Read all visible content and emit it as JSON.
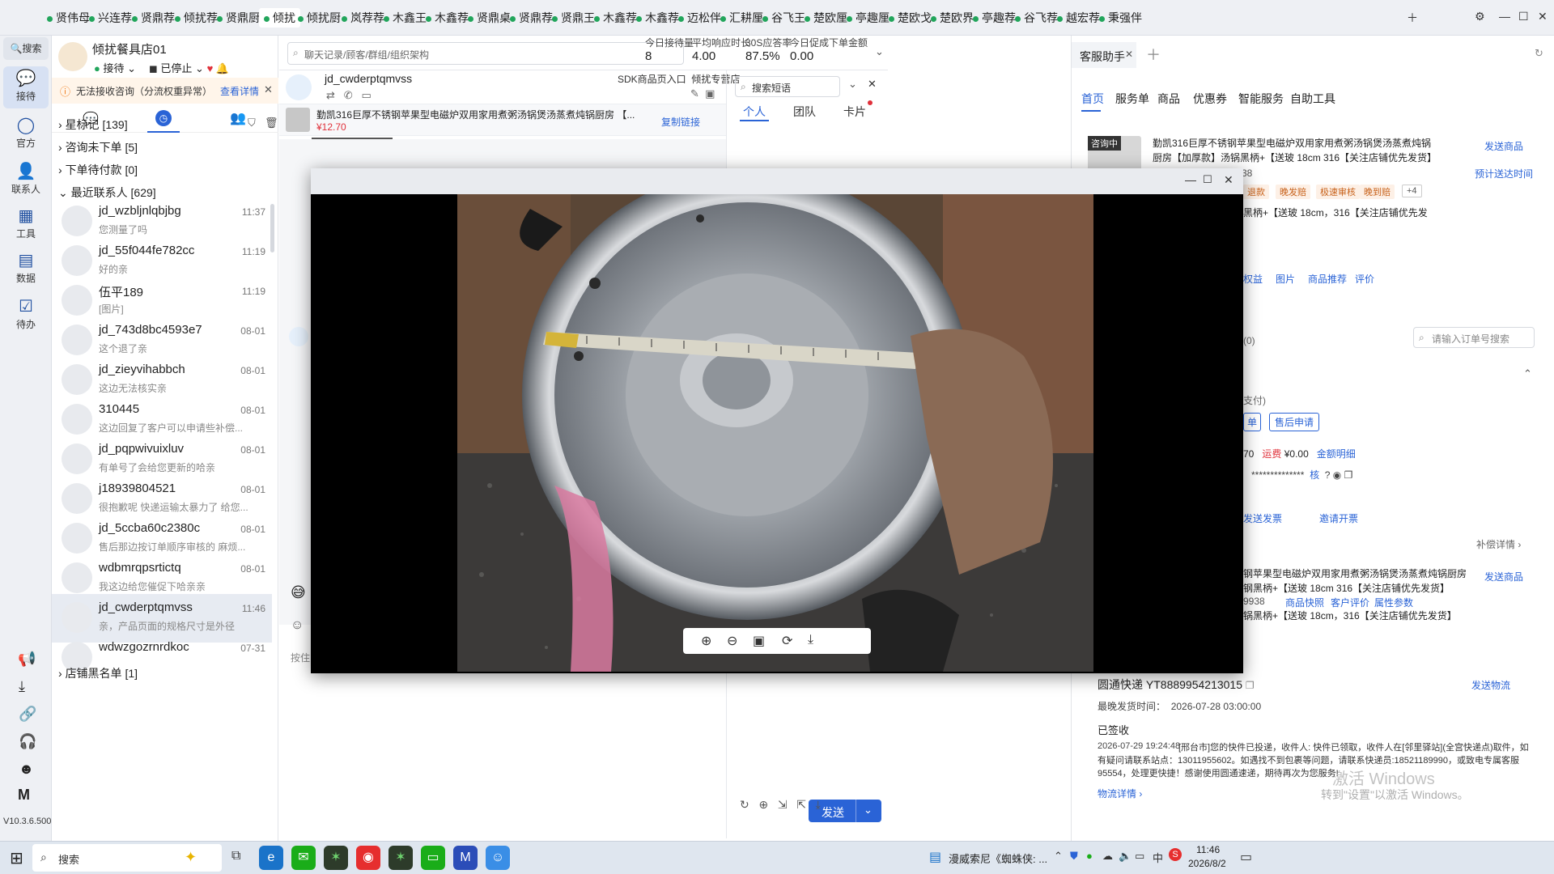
{
  "top_tabs": [
    "贤伟母",
    "兴连荐",
    "贤鼎荐",
    "倾扰荐",
    "贤鼎厨",
    "倾扰",
    "倾扰厨",
    "岚荐荐",
    "木鑫王",
    "木鑫荐",
    "贤鼎桌",
    "贤鼎荐",
    "贤鼎王",
    "木鑫荐",
    "木鑫荐",
    "迈松伴",
    "汇耕厘",
    "谷飞王",
    "楚欧厘",
    "亭趣厘",
    "楚欧戈",
    "楚欧界",
    "亭趣荐",
    "谷飞荐",
    "越宏荐",
    "秉强伴"
  ],
  "rail": {
    "search": "搜索",
    "items": [
      "接待",
      "官方",
      "联系人",
      "工具",
      "数据",
      "待办"
    ],
    "version": "V10.3.6.500"
  },
  "shop": {
    "name": "倾扰餐具店01",
    "status_receive": "接待",
    "status_stop": "已停止"
  },
  "notice": {
    "text": "无法接收咨询（分流权重异常）",
    "link": "查看详情"
  },
  "groups": {
    "star": "星标记 [139]",
    "no_order": "咨询未下单 [5]",
    "pending_pay": "下单待付款 [0]",
    "recent": "最近联系人 [629]",
    "blacklist": "店铺黑名单 [1]"
  },
  "contacts": [
    {
      "name": "jd_wzbljnlqbjbg",
      "time": "11:37",
      "preview": "您测量了吗"
    },
    {
      "name": "jd_55f044fe782cc",
      "time": "11:19",
      "preview": "好的亲"
    },
    {
      "name": "伍平189",
      "time": "11:19",
      "preview": "[图片]"
    },
    {
      "name": "jd_743d8bc4593e7",
      "time": "08-01",
      "preview": "这个退了亲"
    },
    {
      "name": "jd_zieyvihabbch",
      "time": "08-01",
      "preview": "这边无法核实亲"
    },
    {
      "name": "310445",
      "time": "08-01",
      "preview": "这边回复了客户可以申请些补偿..."
    },
    {
      "name": "jd_pqpwivuixluv",
      "time": "08-01",
      "preview": "有单号了会给您更新的哈亲"
    },
    {
      "name": "j18939804521",
      "time": "08-01",
      "preview": "很抱歉呢 快递运输太暴力了 给您..."
    },
    {
      "name": "jd_5ccba60c2380c",
      "time": "08-01",
      "preview": "售后那边按订单顺序审核的 麻烦..."
    },
    {
      "name": "wdbmrqpsrtictq",
      "time": "08-01",
      "preview": "我这边给您催促下哈亲亲"
    },
    {
      "name": "jd_cwderptqmvss",
      "time": "11:46",
      "preview": "亲，产品页面的规格尺寸是外径"
    },
    {
      "name": "wdwzgozrnrdkoc",
      "time": "07-31",
      "preview": ""
    }
  ],
  "search_placeholder": "聊天记录/顾客/群组/组织架构",
  "stats": [
    {
      "label": "今日接待量",
      "value": "8"
    },
    {
      "label": "平均响应时长",
      "value": "4.00"
    },
    {
      "label": "30S应答率",
      "value": "87.5%"
    },
    {
      "label": "今日促成下单金额",
      "value": "0.00"
    }
  ],
  "chat": {
    "customer": "jd_cwderptqmvss",
    "entry": "SDK商品页入口",
    "store": "倾扰专营店",
    "product_title": "勤凯316巨厚不锈钢苹果型电磁炉双用家用煮粥汤锅煲汤蒸煮炖锅厨房 【...",
    "price": "¥12.70",
    "copy_link": "复制链接",
    "input_hint": "按住",
    "send": "发送"
  },
  "phrases": {
    "search_placeholder": "搜索短语",
    "tabs": [
      "个人",
      "团队",
      "卡片"
    ]
  },
  "assistant": {
    "title": "客服助手",
    "tabs": [
      "首页",
      "服务单",
      "商品",
      "优惠券",
      "智能服务",
      "自助工具"
    ],
    "badge": "咨询中",
    "product1_title": "勤凯316巨厚不锈钢苹果型电磁炉双用家用煮粥汤锅煲汤蒸煮炖锅厨房【加厚款】汤锅黑柄+【送玻 18cm 316【关注店铺优先发货】",
    "send_product": "发送商品",
    "estimate": "预计送达时间",
    "p38": "38",
    "tags": [
      "退款",
      "晚发赔",
      "极速审核",
      "晚到赔",
      "+4"
    ],
    "spec": "黑柄+【送玻 18cm，316【关注店铺优先发",
    "links": [
      "权益",
      "图片",
      "商品推荐",
      "评价"
    ],
    "order_search_placeholder": "请输入订单号搜索",
    "orders_count": "(0)",
    "paid": "支付)",
    "single": "单",
    "after_sale": "售后申请",
    "amount_prefix": "70",
    "freight_label": "运费",
    "freight": "¥0.00",
    "amount_detail": "金额明细",
    "masked": "**************",
    "verify": "核",
    "send_invoice": "发送发票",
    "invite_invoice": "邀请开票",
    "compensate": "补偿详情",
    "product2_title": "钢苹果型电磁炉双用家用煮粥汤锅煲汤蒸煮炖锅厨房",
    "product2_spec": "钢黑柄+【送玻 18cm 316【关注店铺优先发货】",
    "p9938": "9938",
    "links2": [
      "商品快照",
      "客户评价",
      "属性参数"
    ],
    "product2_spec2": "锅黑柄+【送玻 18cm，316【关注店铺优先发货】",
    "logistics_title": "圆通快递 YT8889954213015",
    "send_logistics": "发送物流",
    "latest_ship": "最晚发货时间：",
    "latest_ship_time": "2026-07-28 03:00:00",
    "signed": "已签收",
    "signed_time": "2026-07-29 19:24:48",
    "logistics_detail": "[邢台市]您的快件已投递，收件人: 快件已领取，收件人在[邻里驿站](全宫快递点)取件，如有疑问请联系站点：13011955602。如遇找不到包裹等问题，请联系快递员:18521189990，或致电专属客服95554，处理更快捷！感谢使用圆通速递，期待再次为您服务!",
    "logistics_link": "物流详情",
    "activate1": "激活 Windows",
    "activate2": "转到\"设置\"以激活 Windows。"
  },
  "taskbar": {
    "search": "搜索",
    "media": "漫威索尼《蜘蛛侠: ...",
    "ime": "中",
    "time": "11:46",
    "date": "2026/8/2"
  }
}
